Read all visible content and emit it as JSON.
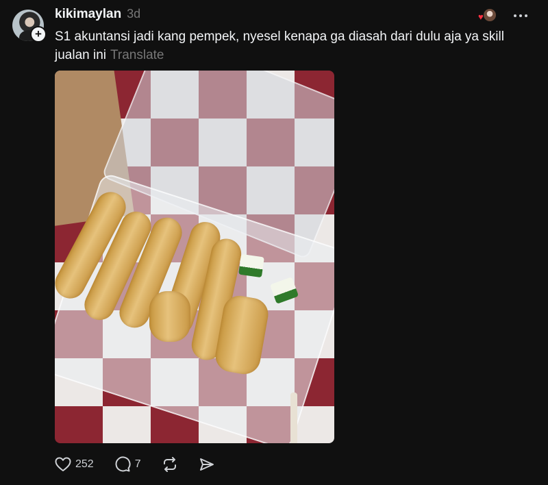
{
  "post": {
    "username": "kikimaylan",
    "time": "3d",
    "caption": "S1 akuntansi jadi kang pempek, nyesel kenapa ga diasah dari dulu aja ya skill jualan ini",
    "translate_label": "Translate",
    "follow_symbol": "+"
  },
  "actions": {
    "likes": "252",
    "replies": "7"
  },
  "icons": {
    "like": "heart-icon",
    "reply": "comment-icon",
    "repost": "repost-icon",
    "share": "share-icon",
    "more": "more-icon"
  },
  "colors": {
    "background": "#101010",
    "text": "#f3f5f7",
    "muted": "#777777",
    "like_red": "#ff3040"
  }
}
